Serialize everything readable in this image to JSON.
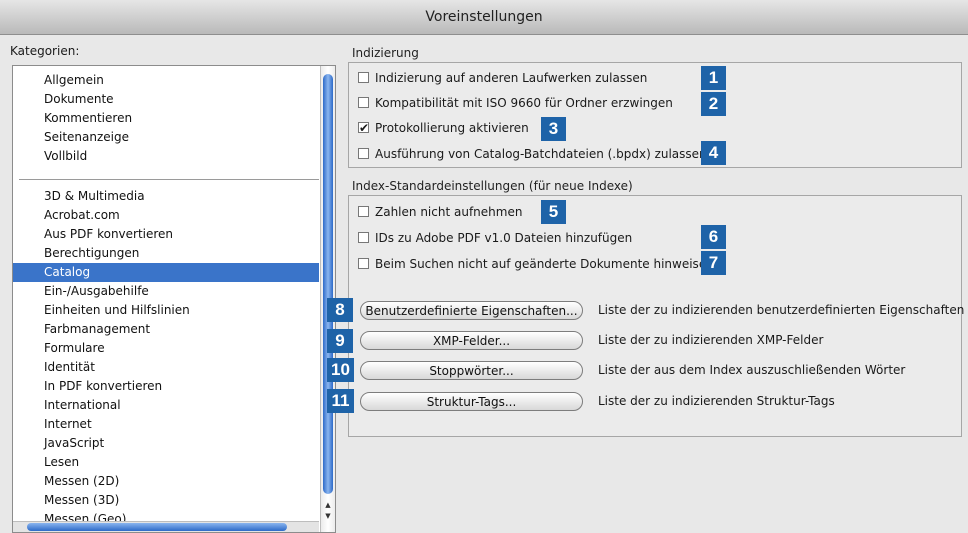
{
  "window": {
    "title": "Voreinstellungen"
  },
  "kategorien": {
    "label": "Kategorien:",
    "group1": [
      "Allgemein",
      "Dokumente",
      "Kommentieren",
      "Seitenanzeige",
      "Vollbild"
    ],
    "group2": [
      "3D & Multimedia",
      "Acrobat.com",
      "Aus PDF konvertieren",
      "Berechtigungen",
      "Catalog",
      "Ein-/Ausgabehilfe",
      "Einheiten und Hilfslinien",
      "Farbmanagement",
      "Formulare",
      "Identität",
      "In PDF konvertieren",
      "International",
      "Internet",
      "JavaScript",
      "Lesen",
      "Messen (2D)",
      "Messen (3D)",
      "Messen (Geo)"
    ],
    "selected": "Catalog"
  },
  "indizierung": {
    "title": "Indizierung",
    "options": [
      {
        "label": "Indizierung auf anderen Laufwerken zulassen",
        "checked": false,
        "badge": "1"
      },
      {
        "label": "Kompatibilität mit ISO 9660 für Ordner erzwingen",
        "checked": false,
        "badge": "2"
      },
      {
        "label": "Protokollierung aktivieren",
        "checked": true,
        "badge": "3"
      },
      {
        "label": "Ausführung von Catalog-Batchdateien (.bpdx) zulassen",
        "checked": false,
        "badge": "4"
      }
    ]
  },
  "index_standard": {
    "title": "Index-Standardeinstellungen (für neue Indexe)",
    "options": [
      {
        "label": "Zahlen nicht aufnehmen",
        "checked": false,
        "badge": "5"
      },
      {
        "label": "IDs zu Adobe PDF v1.0 Dateien hinzufügen",
        "checked": false,
        "badge": "6"
      },
      {
        "label": "Beim Suchen nicht auf geänderte Dokumente hinweisen",
        "checked": false,
        "badge": "7"
      }
    ],
    "buttons": [
      {
        "badge": "8",
        "label": "Benutzerdefinierte Eigenschaften...",
        "description": "Liste der zu indizierenden benutzerdefinierten Eigenschaften"
      },
      {
        "badge": "9",
        "label": "XMP-Felder...",
        "description": "Liste der zu indizierenden XMP-Felder"
      },
      {
        "badge": "10",
        "label": "Stoppwörter...",
        "description": "Liste der aus dem Index auszuschließenden Wörter"
      },
      {
        "badge": "11",
        "label": "Struktur-Tags...",
        "description": "Liste der zu indizierenden Struktur-Tags"
      }
    ]
  }
}
